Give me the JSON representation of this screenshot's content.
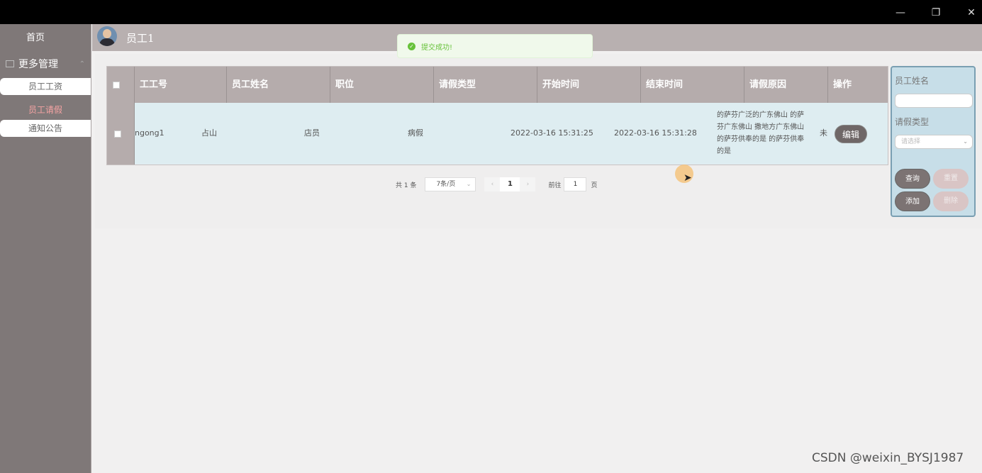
{
  "window": {
    "minimize_icon": "—",
    "restore_icon": "❐",
    "close_icon": "✕"
  },
  "sidebar": {
    "home": "首页",
    "group": "更多管理",
    "items": [
      {
        "label": "员工工资",
        "active": false
      },
      {
        "label": "员工请假",
        "active": true
      },
      {
        "label": "通知公告",
        "active": false
      }
    ]
  },
  "header": {
    "username": "员工1"
  },
  "toast": {
    "message": "提交成功!"
  },
  "table": {
    "columns": [
      "工工号",
      "员工姓名",
      "职位",
      "请假类型",
      "开始时间",
      "结束时间",
      "请假原因",
      "操作"
    ],
    "rows": [
      {
        "emp_no": "ngong1",
        "name": "占山",
        "position": "店员",
        "leave_type": "病假",
        "start_time": "2022-03-16 15:31:25",
        "end_time": "2022-03-16 15:31:28",
        "reason": "的萨芬广泛的广东佛山 的萨芬广东佛山 撒地方广东佛山的萨芬供奉的是 的萨芬供奉的是",
        "status_partial": "未",
        "edit_label": "编辑"
      }
    ]
  },
  "pagination": {
    "total": "共 1 条",
    "page_size": "7条/页",
    "prev_icon": "‹",
    "current_page": "1",
    "next_icon": "›",
    "goto_label": "前往",
    "goto_value": "1",
    "page_suffix": "页"
  },
  "search": {
    "name_label": "员工姓名",
    "type_label": "请假类型",
    "type_placeholder": "请选择",
    "query_btn": "查询",
    "reset_btn": "重置",
    "add_btn": "添加",
    "delete_btn": "删除"
  },
  "watermark": "CSDN @weixin_BYSJ1987"
}
